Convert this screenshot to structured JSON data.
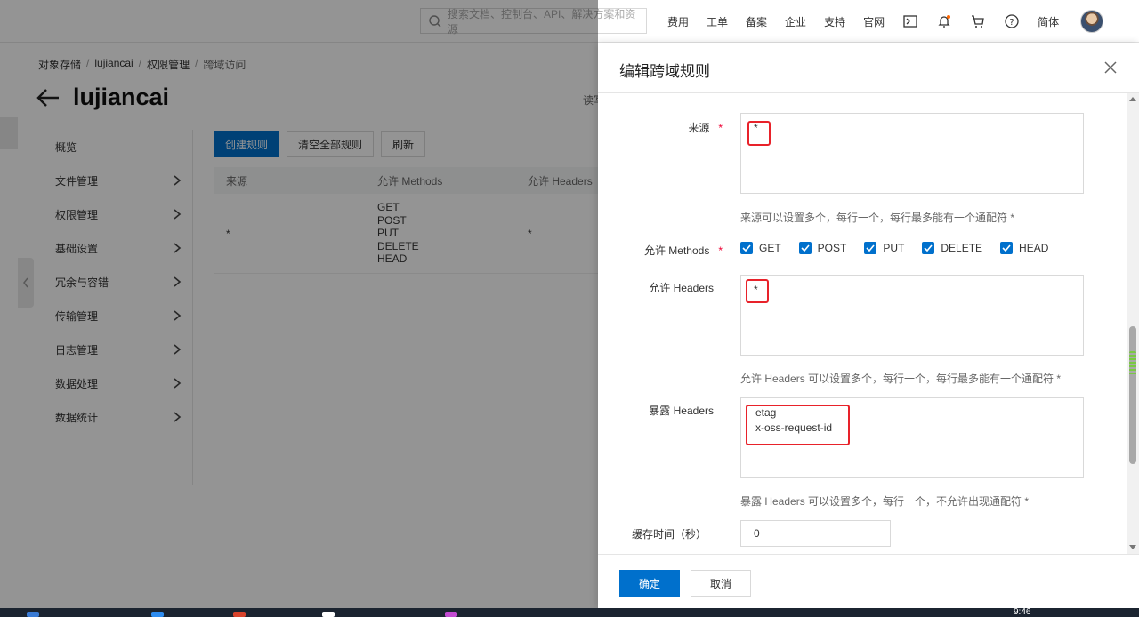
{
  "topbar": {
    "search_placeholder": "搜索文档、控制台、API、解决方案和资源",
    "nav": [
      "费用",
      "工单",
      "备案",
      "企业",
      "支持",
      "官网"
    ],
    "lang": "简体",
    "icons": [
      "terminal-icon",
      "bell-icon",
      "cart-icon",
      "help-icon"
    ]
  },
  "breadcrumb": [
    "对象存储",
    "lujiancai",
    "权限管理",
    "跨域访问"
  ],
  "page": {
    "title": "lujiancai",
    "read_tag": "读写"
  },
  "sidemenu": [
    "概览",
    "文件管理",
    "权限管理",
    "基础设置",
    "冗余与容错",
    "传输管理",
    "日志管理",
    "数据处理",
    "数据统计"
  ],
  "toolbar": {
    "create": "创建规则",
    "clear": "清空全部规则",
    "refresh": "刷新"
  },
  "table": {
    "headers": [
      "来源",
      "允许 Methods",
      "允许 Headers"
    ],
    "rows": [
      {
        "origin": "*",
        "methods": [
          "GET",
          "POST",
          "PUT",
          "DELETE",
          "HEAD"
        ],
        "headers": "*"
      }
    ]
  },
  "drawer": {
    "title": "编辑跨域规则",
    "origin": {
      "label": "来源",
      "value": "*",
      "hint": "来源可以设置多个，每行一个，每行最多能有一个通配符 *"
    },
    "methods": {
      "label": "允许 Methods",
      "options": [
        {
          "label": "GET",
          "checked": true
        },
        {
          "label": "POST",
          "checked": true
        },
        {
          "label": "PUT",
          "checked": true
        },
        {
          "label": "DELETE",
          "checked": true
        },
        {
          "label": "HEAD",
          "checked": true
        }
      ]
    },
    "allow_headers": {
      "label": "允许 Headers",
      "value": "*",
      "hint": "允许 Headers 可以设置多个，每行一个，每行最多能有一个通配符 *"
    },
    "expose_headers": {
      "label": "暴露 Headers",
      "lines": [
        "etag",
        "x-oss-request-id"
      ],
      "hint": "暴露 Headers 可以设置多个，每行一个，不允许出现通配符 *"
    },
    "cache": {
      "label": "缓存时间（秒）",
      "value": "0"
    },
    "ok": "确定",
    "cancel": "取消"
  },
  "taskbar": {
    "clock": "9:46"
  },
  "colors": {
    "primary": "#0070cc",
    "highlight": "#e8222a"
  }
}
